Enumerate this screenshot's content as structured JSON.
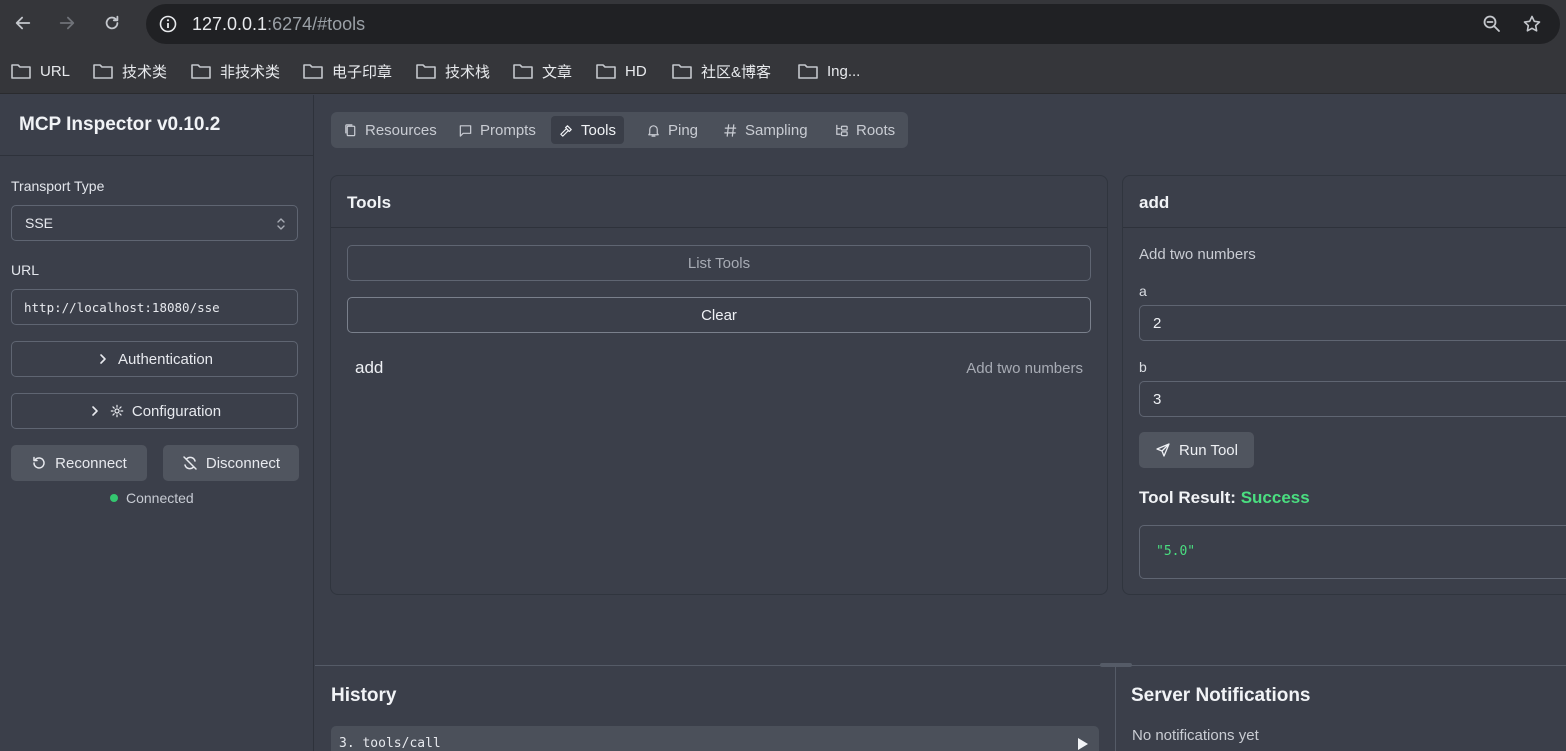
{
  "browser": {
    "url_host": "127.0.0.1",
    "url_rest": ":6274/#tools",
    "bookmarks": [
      "URL",
      "技术类",
      "非技术类",
      "电子印章",
      "技术栈",
      "文章",
      "HD",
      "社区&博客",
      "Ing..."
    ]
  },
  "sidebar": {
    "title": "MCP Inspector v0.10.2",
    "transport_label": "Transport Type",
    "transport_value": "SSE",
    "url_label": "URL",
    "url_value": "http://localhost:18080/sse",
    "auth_label": "Authentication",
    "config_label": "Configuration",
    "reconnect_label": "Reconnect",
    "disconnect_label": "Disconnect",
    "status_text": "Connected",
    "status_color": "#34c770"
  },
  "tabs": [
    {
      "label": "Resources",
      "icon": "files-icon"
    },
    {
      "label": "Prompts",
      "icon": "message-square-icon"
    },
    {
      "label": "Tools",
      "icon": "hammer-icon",
      "active": true
    },
    {
      "label": "Ping",
      "icon": "bell-icon"
    },
    {
      "label": "Sampling",
      "icon": "hash-icon"
    },
    {
      "label": "Roots",
      "icon": "folder-tree-icon"
    }
  ],
  "tools_panel": {
    "title": "Tools",
    "list_button": "List Tools",
    "clear_button": "Clear",
    "tools": [
      {
        "name": "add",
        "description": "Add two numbers"
      }
    ]
  },
  "detail_panel": {
    "title": "add",
    "description": "Add two numbers",
    "params": [
      {
        "name": "a",
        "value": "2"
      },
      {
        "name": "b",
        "value": "3"
      }
    ],
    "run_button": "Run Tool",
    "result_label": "Tool Result:",
    "result_status": "Success",
    "result_value": "\"5.0\"",
    "success_color": "#4ade80"
  },
  "history": {
    "title": "History",
    "items": [
      "3. tools/call"
    ]
  },
  "notifications": {
    "title": "Server Notifications",
    "empty_text": "No notifications yet"
  }
}
